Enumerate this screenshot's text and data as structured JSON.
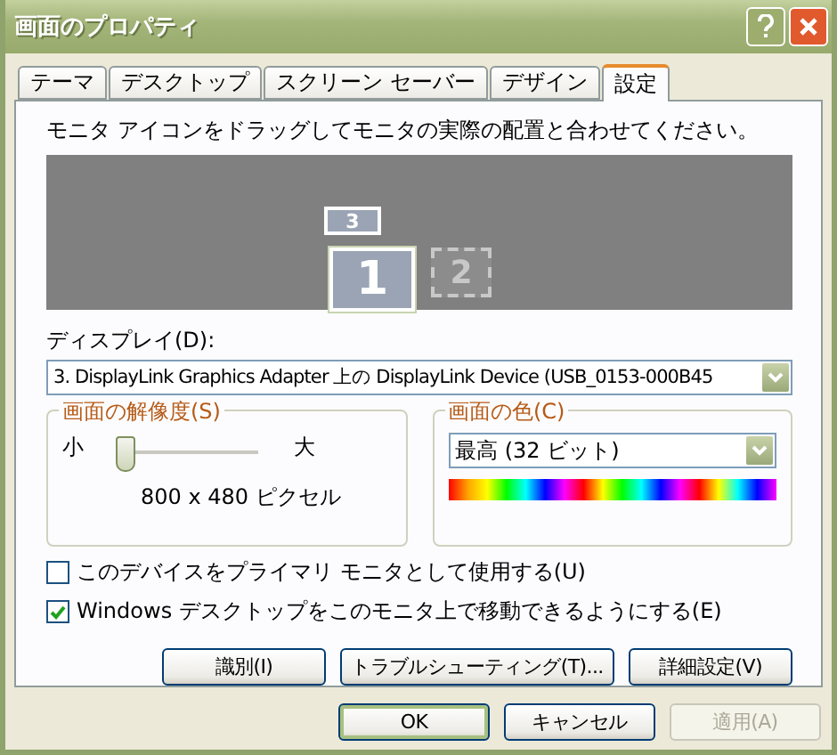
{
  "window": {
    "title": "画面のプロパティ"
  },
  "tabs": [
    {
      "label": "テーマ",
      "selected": false
    },
    {
      "label": "デスクトップ",
      "selected": false
    },
    {
      "label": "スクリーン セーバー",
      "selected": false
    },
    {
      "label": "デザイン",
      "selected": false
    },
    {
      "label": "設定",
      "selected": true
    }
  ],
  "instruction": "モニタ アイコンをドラッグしてモニタの実際の配置と合わせてください。",
  "monitors": [
    {
      "label": "3",
      "selected": false,
      "attached": true
    },
    {
      "label": "1",
      "selected": true,
      "attached": true
    },
    {
      "label": "2",
      "selected": false,
      "attached": false
    }
  ],
  "display": {
    "label": "ディスプレイ(D):",
    "value": "3. DisplayLink Graphics Adapter 上の DisplayLink Device (USB_0153-000B45"
  },
  "resolution": {
    "title": "画面の解像度(S)",
    "min_label": "小",
    "max_label": "大",
    "level": 0,
    "reading": "800 x 480 ピクセル"
  },
  "color_quality": {
    "title": "画面の色(C)",
    "value": "最高 (32 ビット)"
  },
  "checkboxes": [
    {
      "label": "このデバイスをプライマリ モニタとして使用する(U)",
      "checked": false
    },
    {
      "label": "Windows デスクトップをこのモニタ上で移動できるようにする(E)",
      "checked": true
    }
  ],
  "panel_buttons": [
    "識別(I)",
    "トラブルシューティング(T)...",
    "詳細設定(V)"
  ],
  "dialog_buttons": [
    {
      "label": "OK",
      "default": true,
      "disabled": false
    },
    {
      "label": "キャンセル",
      "default": false,
      "disabled": false
    },
    {
      "label": "適用(A)",
      "default": false,
      "disabled": true
    }
  ]
}
